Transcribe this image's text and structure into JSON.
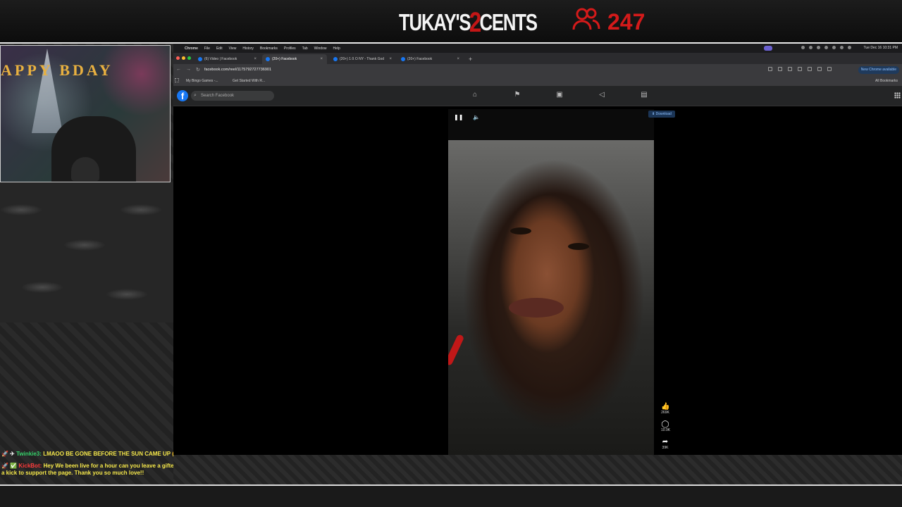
{
  "overlay": {
    "brand_part1": "TUKAY'S",
    "brand_part2": "2",
    "brand_part3": "CENTS",
    "viewer_count": "247",
    "viewer_icon": "users-icon",
    "accent_color": "#d41a1a"
  },
  "webcam": {
    "banner_text": "APPY  BDAY"
  },
  "chat": [
    {
      "user": "Twinkie3:",
      "message": "LMAOO BE GONE BEFORE THE SUN CAME UP 🤔🤔"
    },
    {
      "user": "KickBot:",
      "message": "Hey We been live for a hour can you leave a gifted sub or a kick to support the page. Thank you so much love!!"
    }
  ],
  "mac_menu": {
    "items": [
      "Chrome",
      "File",
      "Edit",
      "View",
      "History",
      "Bookmarks",
      "Profiles",
      "Tab",
      "Window",
      "Help"
    ],
    "clock": "Tue Dec 16 10:31 PM"
  },
  "tabs": [
    {
      "label": "(6) Video | Facebook",
      "active": false
    },
    {
      "label": "(20+) Facebook",
      "active": true
    },
    {
      "label": "(20+) 1 ß O NY - Thank God",
      "active": false
    },
    {
      "label": "(20+) Facebook",
      "active": false
    }
  ],
  "address_bar": {
    "url": "facebook.com/reel/1175792727736901",
    "new_chrome": "New Chrome available"
  },
  "bookmarks": {
    "items": [
      "My Bingo Games -...",
      "Get Started With R..."
    ],
    "all_bookmarks": "All Bookmarks"
  },
  "facebook": {
    "logo": "f",
    "search_placeholder": "Search Facebook",
    "nav_icons": [
      "home-icon",
      "flag-icon",
      "marketplace-icon",
      "megaphone-icon",
      "gaming-icon"
    ]
  },
  "reel": {
    "download_label": "Download",
    "likes": "269K",
    "comments": "10.9K",
    "shares": "39K"
  }
}
